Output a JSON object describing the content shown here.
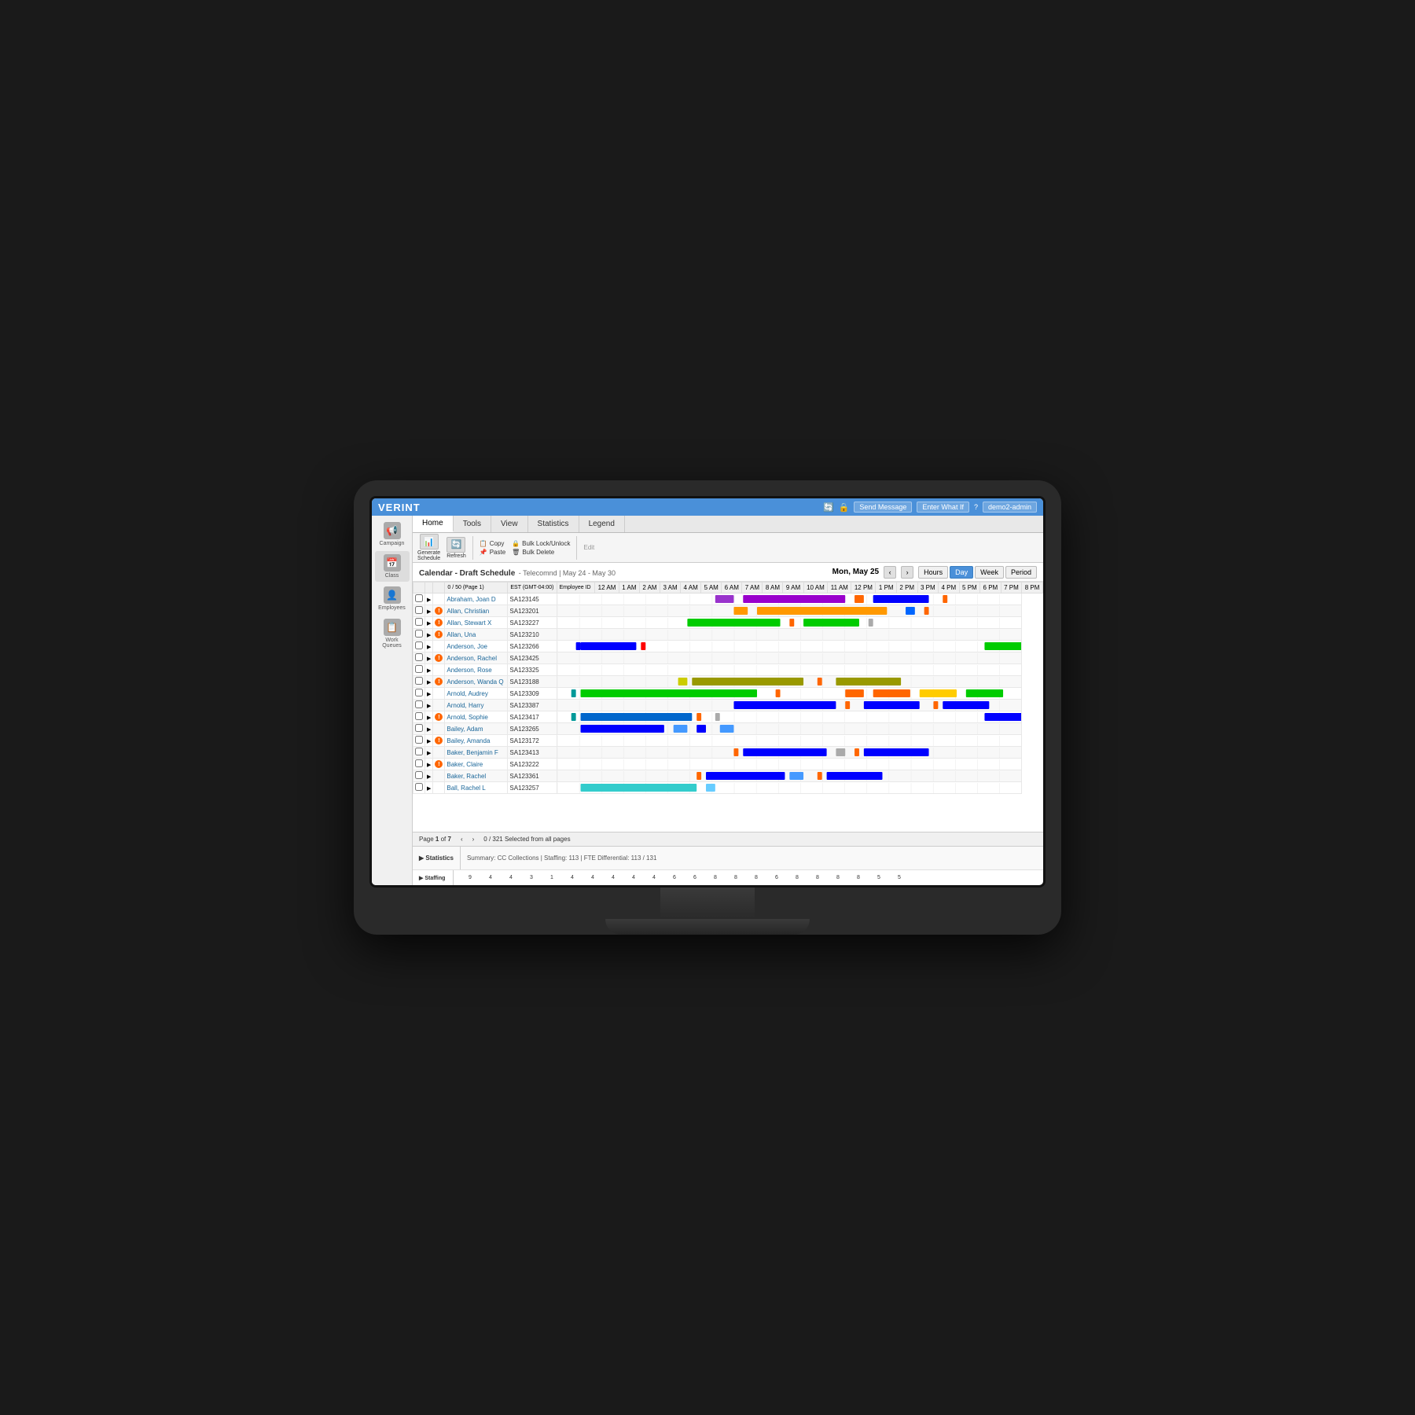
{
  "monitor": {
    "title": "Verint Workforce Management"
  },
  "topBar": {
    "logo": "VERINT",
    "icons": [
      "refresh",
      "lock",
      "send-message",
      "enter-what-if",
      "help",
      "user"
    ],
    "sendMessage": "Send Message",
    "enterWhatIf": "Enter What If",
    "help": "?",
    "user": "demo2-admin"
  },
  "sidebar": {
    "items": [
      {
        "label": "Campaign",
        "icon": "📢"
      },
      {
        "label": "Class",
        "icon": "📅"
      },
      {
        "label": "Employees",
        "icon": "👤"
      },
      {
        "label": "Work Queues",
        "icon": "📋"
      }
    ]
  },
  "navTabs": {
    "tabs": [
      "Home",
      "Tools",
      "View",
      "Statistics",
      "Legend"
    ]
  },
  "toolbar": {
    "generateSchedule": "Generate\nSchedule",
    "refresh": "Refresh",
    "copy": "Copy",
    "paste": "Paste",
    "edit": "Edit",
    "bulkLockUnlock": "Bulk Lock/Unlock",
    "bulkDelete": "Bulk Delete"
  },
  "calendarHeader": {
    "title": "Calendar - Draft Schedule",
    "subtitle": "Telecomnd | May 24 - May 30",
    "date": "Mon, May 25",
    "viewButtons": [
      "Hours",
      "Day",
      "Week",
      "Period"
    ],
    "activeView": "Day"
  },
  "tableHeader": {
    "checkCol": "",
    "expandCol": "",
    "alertCol": "",
    "pageInfo": "0 / 50 (Page 1)",
    "timezone": "EST (GMT-04:00)",
    "employeeId": "Employee ID",
    "timeLabels": [
      "12 AM",
      "1 AM",
      "2 AM",
      "3 AM",
      "4 AM",
      "5 AM",
      "6 AM",
      "7 AM",
      "8 AM",
      "9 AM",
      "10 AM",
      "11 AM",
      "12 PM",
      "1 PM",
      "2 PM",
      "3 PM",
      "4 PM",
      "5 PM",
      "6 PM",
      "7 PM",
      "8 PM"
    ]
  },
  "employees": [
    {
      "name": "Abraham, Joan D",
      "id": "SA123145",
      "hasAlert": false
    },
    {
      "name": "Allan, Christian",
      "id": "SA123201",
      "hasAlert": true
    },
    {
      "name": "Allan, Stewart X",
      "id": "SA123227",
      "hasAlert": true
    },
    {
      "name": "Allan, Una",
      "id": "SA123210",
      "hasAlert": true
    },
    {
      "name": "Anderson, Joe",
      "id": "SA123266",
      "hasAlert": false
    },
    {
      "name": "Anderson, Rachel",
      "id": "SA123425",
      "hasAlert": true
    },
    {
      "name": "Anderson, Rose",
      "id": "SA123325",
      "hasAlert": false
    },
    {
      "name": "Anderson, Wanda Q",
      "id": "SA123188",
      "hasAlert": true
    },
    {
      "name": "Arnold, Audrey",
      "id": "SA123309",
      "hasAlert": false
    },
    {
      "name": "Arnold, Harry",
      "id": "SA123387",
      "hasAlert": false
    },
    {
      "name": "Arnold, Sophie",
      "id": "SA123417",
      "hasAlert": true
    },
    {
      "name": "Bailey, Adam",
      "id": "SA123265",
      "hasAlert": false
    },
    {
      "name": "Bailey, Amanda",
      "id": "SA123172",
      "hasAlert": true
    },
    {
      "name": "Baker, Benjamin F",
      "id": "SA123413",
      "hasAlert": false
    },
    {
      "name": "Baker, Claire",
      "id": "SA123222",
      "hasAlert": true
    },
    {
      "name": "Baker, Rachel",
      "id": "SA123361",
      "hasAlert": false
    },
    {
      "name": "Ball, Rachel L",
      "id": "SA123257",
      "hasAlert": false
    }
  ],
  "statusBar": {
    "pageInfo": "Page 1 of 7",
    "selectedInfo": "0 / 321 Selected from all pages"
  },
  "statistics": {
    "label": "Statistics",
    "summary": "Summary: CC Collections",
    "staffing": "Staffing: 113",
    "fteDifferential": "FTE Differential: 113 / 131",
    "staffingLabel": "Staffing",
    "numbers": [
      "9",
      "4",
      "4",
      "3",
      "1",
      "4",
      "4",
      "4",
      "4",
      "4",
      "6",
      "6",
      "8",
      "8",
      "8",
      "6",
      "8",
      "8",
      "8",
      "8",
      "5",
      "5"
    ]
  }
}
